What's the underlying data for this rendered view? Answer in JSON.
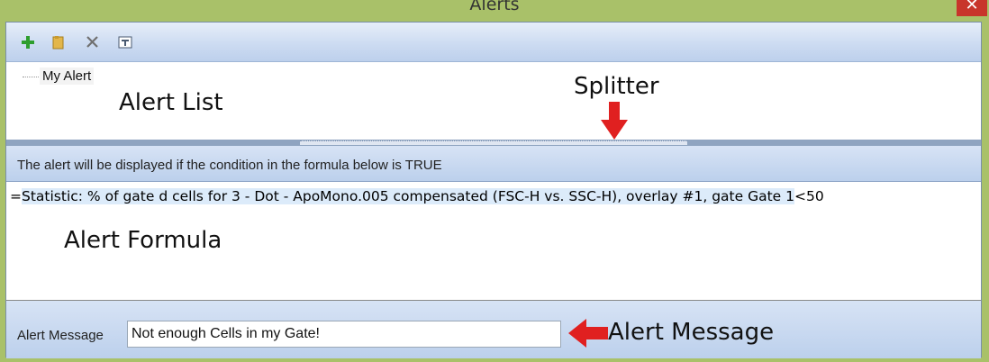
{
  "window": {
    "title": "Alerts",
    "close_glyph": "✕"
  },
  "toolbar": {
    "buttons": [
      {
        "icon": "add-icon",
        "color": "#2e9e2e"
      },
      {
        "icon": "folder-icon",
        "color": "#d9a93a"
      },
      {
        "icon": "delete-icon",
        "color": "#707070"
      },
      {
        "icon": "rename-icon",
        "color": "#4a5a70"
      }
    ]
  },
  "alert_list": {
    "items": [
      {
        "label": "My Alert"
      }
    ]
  },
  "formula": {
    "header": "The alert will be displayed if the condition in the formula below is TRUE",
    "prefix": "=",
    "statistic": "Statistic: % of gate d cells for 3 - Dot - ApoMono.005 compensated (FSC-H vs. SSC-H), overlay #1, gate Gate 1",
    "suffix": "<50"
  },
  "message": {
    "label": "Alert Message",
    "value": "Not enough Cells in my Gate!"
  },
  "annotations": {
    "alert_list": "Alert List",
    "splitter": "Splitter",
    "alert_formula": "Alert Formula",
    "alert_message": "Alert Message",
    "arrow_color": "#e02020"
  }
}
